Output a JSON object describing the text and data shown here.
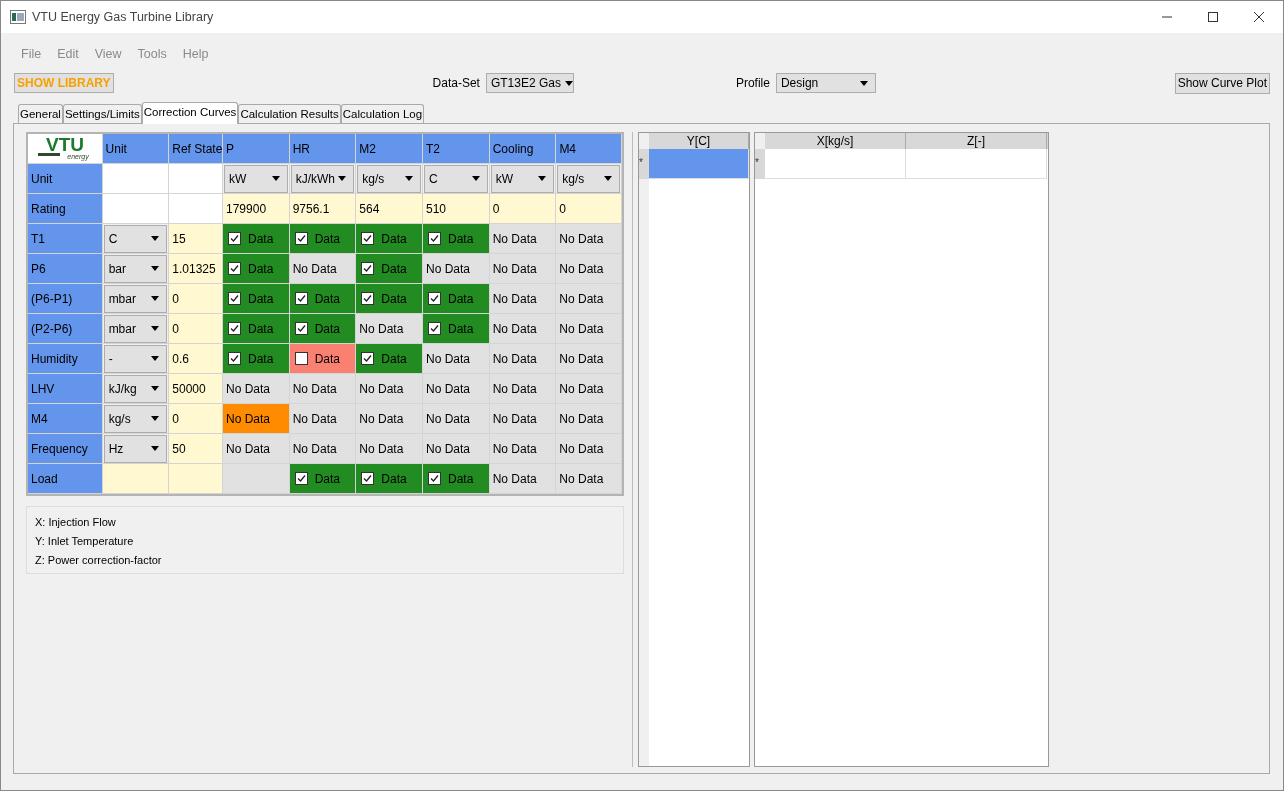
{
  "window": {
    "title": "VTU Energy Gas Turbine Library"
  },
  "menu": [
    "File",
    "Edit",
    "View",
    "Tools",
    "Help"
  ],
  "toolbar": {
    "library_button": "SHOW LIBRARY",
    "dataset_label": "Data-Set",
    "dataset_value": "GT13E2  Gas",
    "profile_label": "Profile",
    "profile_value": "Design",
    "plot_button": "Show Curve Plot"
  },
  "tabs": [
    {
      "label": "General",
      "selected": false
    },
    {
      "label": "Settings/Limits",
      "selected": false
    },
    {
      "label": "Correction Curves",
      "selected": true
    },
    {
      "label": "Calculation Results",
      "selected": false
    },
    {
      "label": "Calculation Log",
      "selected": false
    }
  ],
  "matrix": {
    "logo": {
      "text": "VTU",
      "subtext": "energy"
    },
    "columns": [
      "Unit",
      "Ref State",
      "P",
      "HR",
      "M2",
      "T2",
      "Cooling",
      "M4"
    ],
    "rows": [
      {
        "kind": "units",
        "label": "Unit",
        "values": [
          "kW",
          "kJ/kWh",
          "kg/s",
          "C",
          "kW",
          "kg/s"
        ]
      },
      {
        "kind": "rating",
        "label": "Rating",
        "values": [
          "179900",
          "9756.1",
          "564",
          "510",
          "0",
          "0"
        ]
      },
      {
        "kind": "curve",
        "label": "T1",
        "unit": "C",
        "ref": "15",
        "cells": [
          {
            "kind": "data",
            "label": "Data",
            "checked": true,
            "selected": false
          },
          {
            "kind": "data",
            "label": "Data",
            "checked": true,
            "selected": false
          },
          {
            "kind": "data",
            "label": "Data",
            "checked": true,
            "selected": false
          },
          {
            "kind": "data",
            "label": "Data",
            "checked": true,
            "selected": false
          },
          {
            "kind": "nodata",
            "label": "No Data",
            "selected": false
          },
          {
            "kind": "nodata",
            "label": "No Data",
            "selected": false
          }
        ]
      },
      {
        "kind": "curve",
        "label": "P6",
        "unit": "bar",
        "ref": "1.01325",
        "cells": [
          {
            "kind": "data",
            "label": "Data",
            "checked": true,
            "selected": false
          },
          {
            "kind": "nodata",
            "label": "No Data",
            "selected": false
          },
          {
            "kind": "data",
            "label": "Data",
            "checked": true,
            "selected": false
          },
          {
            "kind": "nodata",
            "label": "No Data",
            "selected": false
          },
          {
            "kind": "nodata",
            "label": "No Data",
            "selected": false
          },
          {
            "kind": "nodata",
            "label": "No Data",
            "selected": false
          }
        ]
      },
      {
        "kind": "curve",
        "label": "(P6-P1)",
        "unit": "mbar",
        "ref": "0",
        "cells": [
          {
            "kind": "data",
            "label": "Data",
            "checked": true,
            "selected": false
          },
          {
            "kind": "data",
            "label": "Data",
            "checked": true,
            "selected": false
          },
          {
            "kind": "data",
            "label": "Data",
            "checked": true,
            "selected": false
          },
          {
            "kind": "data",
            "label": "Data",
            "checked": true,
            "selected": false
          },
          {
            "kind": "nodata",
            "label": "No Data",
            "selected": false
          },
          {
            "kind": "nodata",
            "label": "No Data",
            "selected": false
          }
        ]
      },
      {
        "kind": "curve",
        "label": "(P2-P6)",
        "unit": "mbar",
        "ref": "0",
        "cells": [
          {
            "kind": "data",
            "label": "Data",
            "checked": true,
            "selected": false
          },
          {
            "kind": "data",
            "label": "Data",
            "checked": true,
            "selected": false
          },
          {
            "kind": "nodata",
            "label": "No Data",
            "selected": false
          },
          {
            "kind": "data",
            "label": "Data",
            "checked": true,
            "selected": false
          },
          {
            "kind": "nodata",
            "label": "No Data",
            "selected": false
          },
          {
            "kind": "nodata",
            "label": "No Data",
            "selected": false
          }
        ]
      },
      {
        "kind": "curve",
        "label": "Humidity",
        "unit": "-",
        "ref": "0.6",
        "cells": [
          {
            "kind": "data",
            "label": "Data",
            "checked": true,
            "selected": false
          },
          {
            "kind": "data",
            "label": "Data",
            "checked": false,
            "selected": false
          },
          {
            "kind": "data",
            "label": "Data",
            "checked": true,
            "selected": false
          },
          {
            "kind": "nodata",
            "label": "No Data",
            "selected": false
          },
          {
            "kind": "nodata",
            "label": "No Data",
            "selected": false
          },
          {
            "kind": "nodata",
            "label": "No Data",
            "selected": false
          }
        ]
      },
      {
        "kind": "curve",
        "label": "LHV",
        "unit": "kJ/kg",
        "ref": "50000",
        "cells": [
          {
            "kind": "nodata",
            "label": "No Data",
            "selected": false
          },
          {
            "kind": "nodata",
            "label": "No Data",
            "selected": false
          },
          {
            "kind": "nodata",
            "label": "No Data",
            "selected": false
          },
          {
            "kind": "nodata",
            "label": "No Data",
            "selected": false
          },
          {
            "kind": "nodata",
            "label": "No Data",
            "selected": false
          },
          {
            "kind": "nodata",
            "label": "No Data",
            "selected": false
          }
        ]
      },
      {
        "kind": "curve",
        "label": "M4",
        "unit": "kg/s",
        "ref": "0",
        "cells": [
          {
            "kind": "nodata",
            "label": "No Data",
            "selected": true
          },
          {
            "kind": "nodata",
            "label": "No Data",
            "selected": false
          },
          {
            "kind": "nodata",
            "label": "No Data",
            "selected": false
          },
          {
            "kind": "nodata",
            "label": "No Data",
            "selected": false
          },
          {
            "kind": "nodata",
            "label": "No Data",
            "selected": false
          },
          {
            "kind": "nodata",
            "label": "No Data",
            "selected": false
          }
        ]
      },
      {
        "kind": "curve",
        "label": "Frequency",
        "unit": "Hz",
        "ref": "50",
        "cells": [
          {
            "kind": "nodata",
            "label": "No Data",
            "selected": false
          },
          {
            "kind": "nodata",
            "label": "No Data",
            "selected": false
          },
          {
            "kind": "nodata",
            "label": "No Data",
            "selected": false
          },
          {
            "kind": "nodata",
            "label": "No Data",
            "selected": false
          },
          {
            "kind": "nodata",
            "label": "No Data",
            "selected": false
          },
          {
            "kind": "nodata",
            "label": "No Data",
            "selected": false
          }
        ]
      },
      {
        "kind": "curve",
        "label": "Load",
        "cells": [
          {
            "kind": "empty",
            "selected": false
          },
          {
            "kind": "data",
            "label": "Data",
            "checked": true,
            "selected": false
          },
          {
            "kind": "data",
            "label": "Data",
            "checked": true,
            "selected": false
          },
          {
            "kind": "data",
            "label": "Data",
            "checked": true,
            "selected": false
          },
          {
            "kind": "nodata",
            "label": "No Data",
            "selected": false
          },
          {
            "kind": "nodata",
            "label": "No Data",
            "selected": false
          }
        ]
      }
    ]
  },
  "legend": [
    "X:  Injection Flow",
    "Y:  Inlet Temperature",
    "Z:  Power correction-factor"
  ],
  "y_table": {
    "columns": [
      "Y[C]"
    ],
    "row_marker": "*"
  },
  "xz_table": {
    "columns": [
      "X[kg/s]",
      "Z[-]"
    ],
    "row_marker": "*"
  }
}
